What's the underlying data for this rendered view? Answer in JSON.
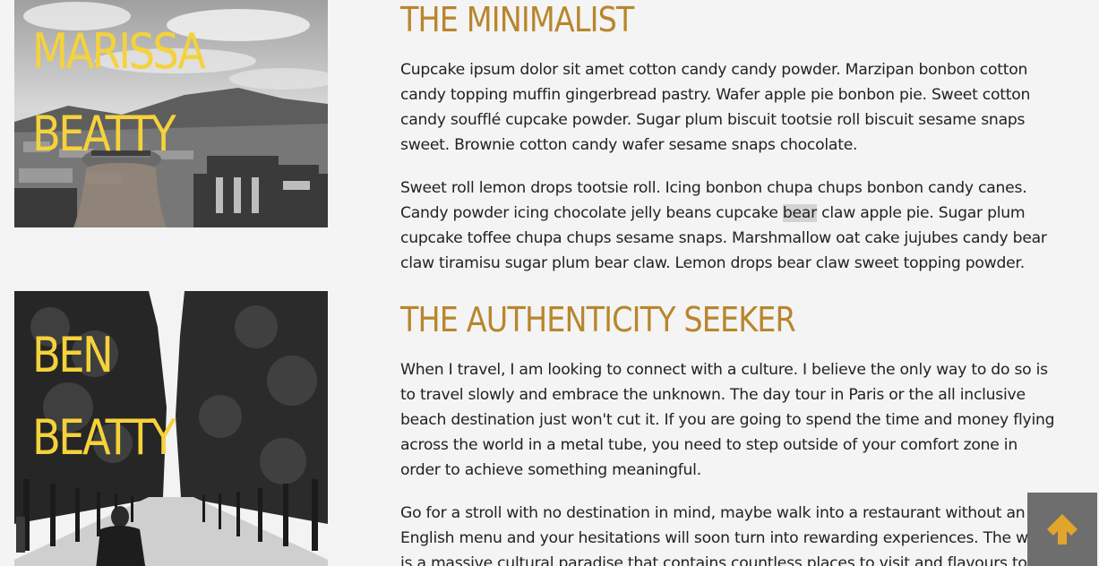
{
  "profiles": [
    {
      "name_line1": "MARISSA",
      "name_line2": "BEATTY",
      "heading": "THE MINIMALIST",
      "paragraph1": "Cupcake ipsum dolor sit amet cotton candy candy powder. Marzipan bonbon cotton candy topping muffin gingerbread pastry. Wafer apple pie bonbon pie. Sweet cotton candy soufflé cupcake powder. Sugar plum biscuit tootsie roll biscuit sesame snaps sweet. Brownie cotton candy wafer sesame snaps chocolate.",
      "paragraph2_before": "Sweet roll lemon drops tootsie roll. Icing bonbon chupa chups bonbon candy canes. Candy powder icing chocolate jelly beans cupcake ",
      "paragraph2_highlight": "bear",
      "paragraph2_after": " claw apple pie. Sugar plum cupcake toffee chupa chups sesame snaps. Marshmallow oat cake jujubes candy bear claw tiramisu sugar plum bear claw. Lemon drops bear claw sweet topping powder."
    },
    {
      "name_line1": "BEN",
      "name_line2": "BEATTY",
      "heading": "THE AUTHENTICITY SEEKER",
      "paragraph1": "When I travel, I am looking to connect with a culture. I believe the only way to do so is to travel slowly and embrace the unknown. The day tour in Paris or the all inclusive beach destination just won't cut it. If you are going to spend the time and money flying across the world in a metal tube, you need to step outside of your comfort zone in order to achieve something meaningful.",
      "paragraph2": "Go for a stroll with no destination in mind, maybe walk into a restaurant without an English menu and your hesitations will soon turn into rewarding experiences. The world is a massive cultural paradise that contains countless places to visit and flavours to"
    }
  ],
  "scroll_top_icon": "arrow-up-icon",
  "colors": {
    "name": "#f5d23b",
    "heading": "#b8862c",
    "background": "#f4f4f4",
    "scroll_button": "#6e6e6e",
    "arrow": "#e0a52a"
  }
}
